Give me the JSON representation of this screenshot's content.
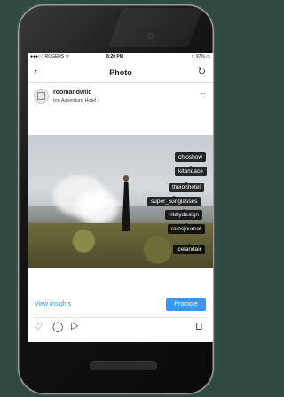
{
  "status_bar": {
    "carrier": "●●●○○ ROGERS ᯤ",
    "time": "8:20 PM",
    "battery": "⬆ 97% ▭"
  },
  "nav": {
    "title": "Photo",
    "back_icon": "chevron-left-icon",
    "refresh_icon": "refresh-icon"
  },
  "post": {
    "username": "roomandwild",
    "location": "Ion Adventure Hotel ›",
    "more": "···"
  },
  "tags": [
    "chloshow",
    "kitandace",
    "theionhotel",
    "super_sunglasses",
    "vitalydesign",
    "rainsjournal",
    "icelandair"
  ],
  "actions": {
    "view_insights": "View Insights",
    "promote": "Promote"
  },
  "icons": {
    "like": "♡",
    "comment": "◯",
    "share": "◁",
    "save": "⊓"
  },
  "colors": {
    "accent": "#3897f0"
  }
}
